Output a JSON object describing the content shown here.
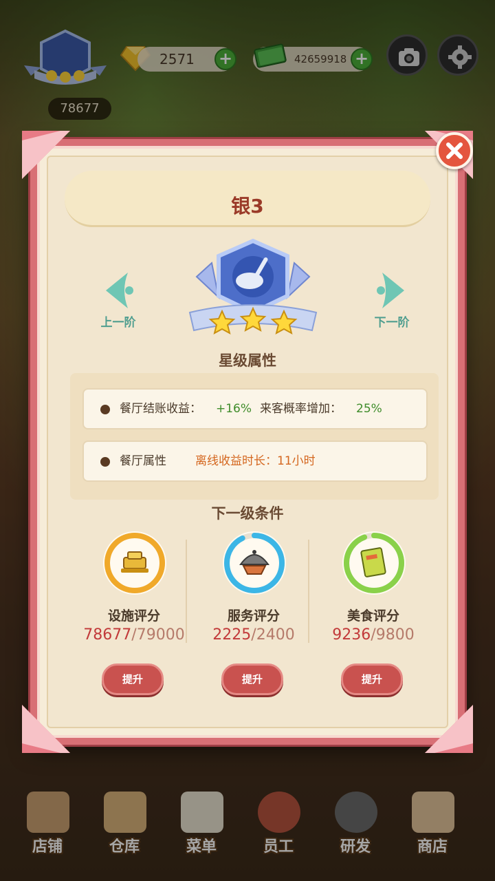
{
  "hud": {
    "player_score": "78677",
    "gems": "2571",
    "cash": "42659918"
  },
  "modal": {
    "title": "银3",
    "prev_label": "上一阶",
    "next_label": "下一阶",
    "star_attr_heading": "星级属性",
    "row1": {
      "label1": "餐厅结账收益：",
      "value1": "+16%",
      "label2": "来客概率增加：",
      "value2": "25%"
    },
    "row2": {
      "label": "餐厅属性",
      "text": "离线收益时长：11小时"
    },
    "next_level_heading": "下一级条件",
    "requirements": [
      {
        "label": "设施评分",
        "current": "78677",
        "target": "/79000",
        "button": "提升",
        "ring_color": "#f0a92a",
        "progress": 0.996
      },
      {
        "label": "服务评分",
        "current": "2225",
        "target": "/2400",
        "button": "提升",
        "ring_color": "#3cb6e6",
        "progress": 0.927
      },
      {
        "label": "美食评分",
        "current": "9236",
        "target": "/9800",
        "button": "提升",
        "ring_color": "#8ad14a",
        "progress": 0.942
      }
    ]
  },
  "bottom_nav": [
    {
      "label": "店铺"
    },
    {
      "label": "仓库"
    },
    {
      "label": "菜单"
    },
    {
      "label": "员工"
    },
    {
      "label": "研发"
    },
    {
      "label": "商店"
    }
  ]
}
